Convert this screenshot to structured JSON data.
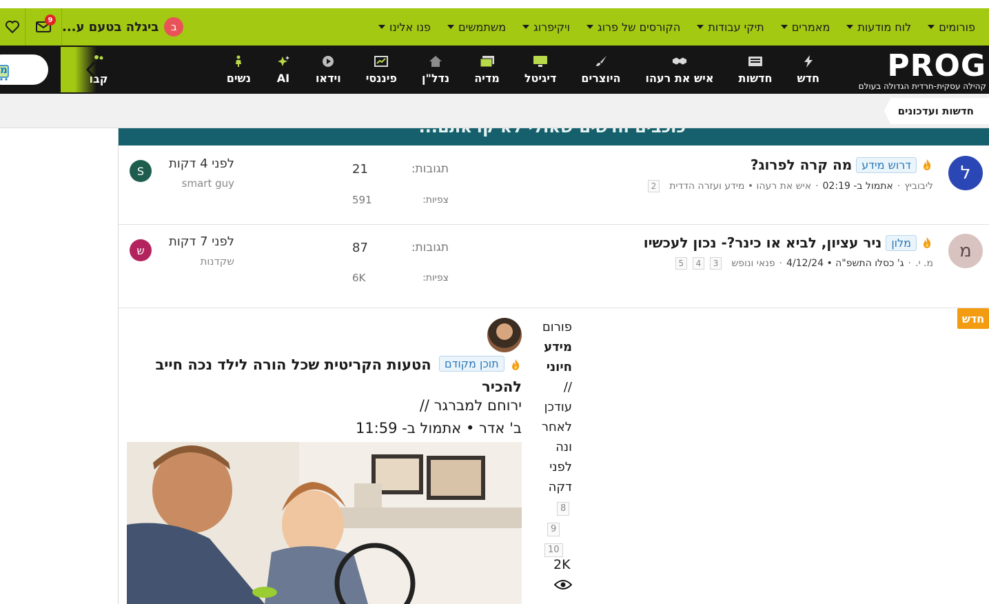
{
  "topbar": {
    "menu": [
      {
        "label": "פורומים"
      },
      {
        "label": "לוח מודעות"
      },
      {
        "label": "מאמרים"
      },
      {
        "label": "תיקי עבודות"
      },
      {
        "label": "הקורסים של פרוג"
      },
      {
        "label": "ויקיפרוג"
      },
      {
        "label": "משתמשים"
      },
      {
        "label": "פנו אלינו"
      }
    ],
    "user_initial": "ב",
    "user_name": "ביגלה בטעם ע...",
    "mail_count": "9"
  },
  "logo": {
    "text": "PROG",
    "tagline": "קהילה עסקית-חרדית הגדולה בעולם"
  },
  "nav": [
    {
      "label": "חדש",
      "icon": "lightning-icon"
    },
    {
      "label": "חדשות",
      "icon": "newspaper-icon"
    },
    {
      "label": "איש את רעהו",
      "icon": "handshake-icon"
    },
    {
      "label": "היוצרים",
      "icon": "brush-icon"
    },
    {
      "label": "דיגיטל",
      "icon": "monitor-icon"
    },
    {
      "label": "מדיה",
      "icon": "images-icon"
    },
    {
      "label": "נדל\"ן",
      "icon": "house-icon"
    },
    {
      "label": "פיננסי",
      "icon": "chart-icon"
    },
    {
      "label": "וידאו",
      "icon": "play-icon"
    },
    {
      "label": "AI",
      "icon": "sparkle-icon"
    },
    {
      "label": "נשים",
      "icon": "woman-icon"
    }
  ],
  "nav_partial": {
    "label": "קבו"
  },
  "travel_button": {
    "label": "מ"
  },
  "breadcrumb": {
    "label": "חדשות ועדכונים"
  },
  "panel_header": {
    "label": "כוכבים חדשים שאולי לא קראתם..."
  },
  "threads": [
    {
      "avatar": "ל",
      "avatar_color": "#2b47b5",
      "prefix": "דרוש מידע",
      "title": "מה קרה לפרוג?",
      "author": "ליבוביץ",
      "date": "אתמול ב- 02:19",
      "forums": "איש את רעהו • מידע ועזרה הדדית",
      "pages": [
        "2"
      ],
      "replies_label": "תגובות:",
      "replies": "21",
      "views_label": "צפיות:",
      "views": "591",
      "last_time": "לפני 4 דקות",
      "last_user": "smart guy",
      "last_initial": "S",
      "last_color": "#1f5d4e"
    },
    {
      "avatar": "מ",
      "avatar_color": "#d9c3c1",
      "prefix": "מלון",
      "title": "ניר עציון, לביא או כינר?- נכון לעכשיו",
      "author": "מ. י.",
      "date": "ג' כסלו התשפ\"ה • 4/12/24",
      "forums": "פנאי ונופש",
      "pages": [
        "3",
        "4",
        "5"
      ],
      "replies_label": "תגובות:",
      "replies": "87",
      "views_label": "צפיות:",
      "views": "6K",
      "last_time": "לפני 7 דקות",
      "last_user": "שקדנות",
      "last_initial": "ש",
      "last_color": "#b3245e"
    }
  ],
  "featured": {
    "badge": "חדש",
    "forum_lines": [
      "פורום",
      "מידע",
      "חיוני",
      "//",
      "עודכן",
      "לאחר",
      "ונה",
      "לפני",
      "דקה"
    ],
    "forum_bold": [
      1,
      2
    ],
    "pages": [
      "8",
      "9",
      "10"
    ],
    "views": "2K",
    "prefix": "תוכן מקודם",
    "title": "הטעות הקריטית שכל הורה לילד נכה חייב להכיר",
    "author": "ירוחם למברגר //",
    "date": "ב' אדר • אתמול ב- 11:59"
  },
  "colors": {
    "green": "#a3c912",
    "dark": "#151515",
    "teal": "#16606d",
    "orange": "#f39c12"
  }
}
